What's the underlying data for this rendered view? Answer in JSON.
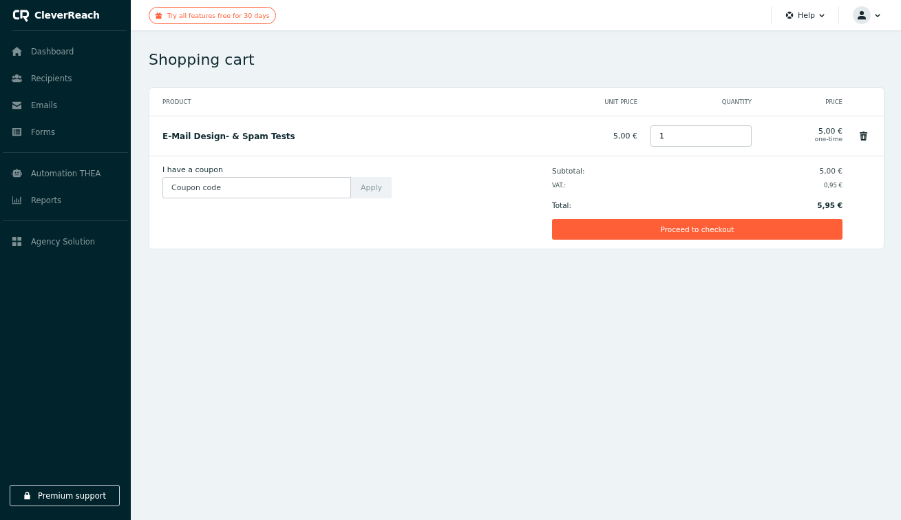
{
  "sidebar": {
    "brand": "CleverReach",
    "groups": [
      [
        {
          "label": "Dashboard",
          "selected": false
        },
        {
          "label": "Recipients",
          "selected": false
        },
        {
          "label": "Emails",
          "selected": false
        },
        {
          "label": "Forms",
          "selected": false
        }
      ],
      [
        {
          "label": "Automation THEA",
          "selected": false
        },
        {
          "label": "Reports",
          "selected": false
        }
      ],
      [
        {
          "label": "Agency Solution",
          "selected": false
        }
      ]
    ],
    "support_button": "Premium support"
  },
  "topbar": {
    "trial_badge": "Try all features free for 30 days",
    "help": "Help"
  },
  "page": {
    "title": "Shopping cart"
  },
  "cart": {
    "columns": [
      "PRODUCT",
      "UNIT PRICE",
      "QUANTITY",
      "PRICE"
    ],
    "rows": [
      {
        "product": "E-Mail Design- & Spam Tests",
        "unit_price": "5,00 €",
        "quantity": "1",
        "price": "5,00 €",
        "billing": "one-time"
      }
    ],
    "coupon": {
      "label": "I have a coupon",
      "placeholder": "Coupon code",
      "apply": "Apply"
    },
    "totals": {
      "subtotal_label": "Subtotal:",
      "subtotal": "5,00 €",
      "vat_label": "VAT.:",
      "vat": "0,95 €",
      "total_label": "Total:",
      "total": "5,95 €"
    },
    "checkout": "Proceed to checkout"
  }
}
